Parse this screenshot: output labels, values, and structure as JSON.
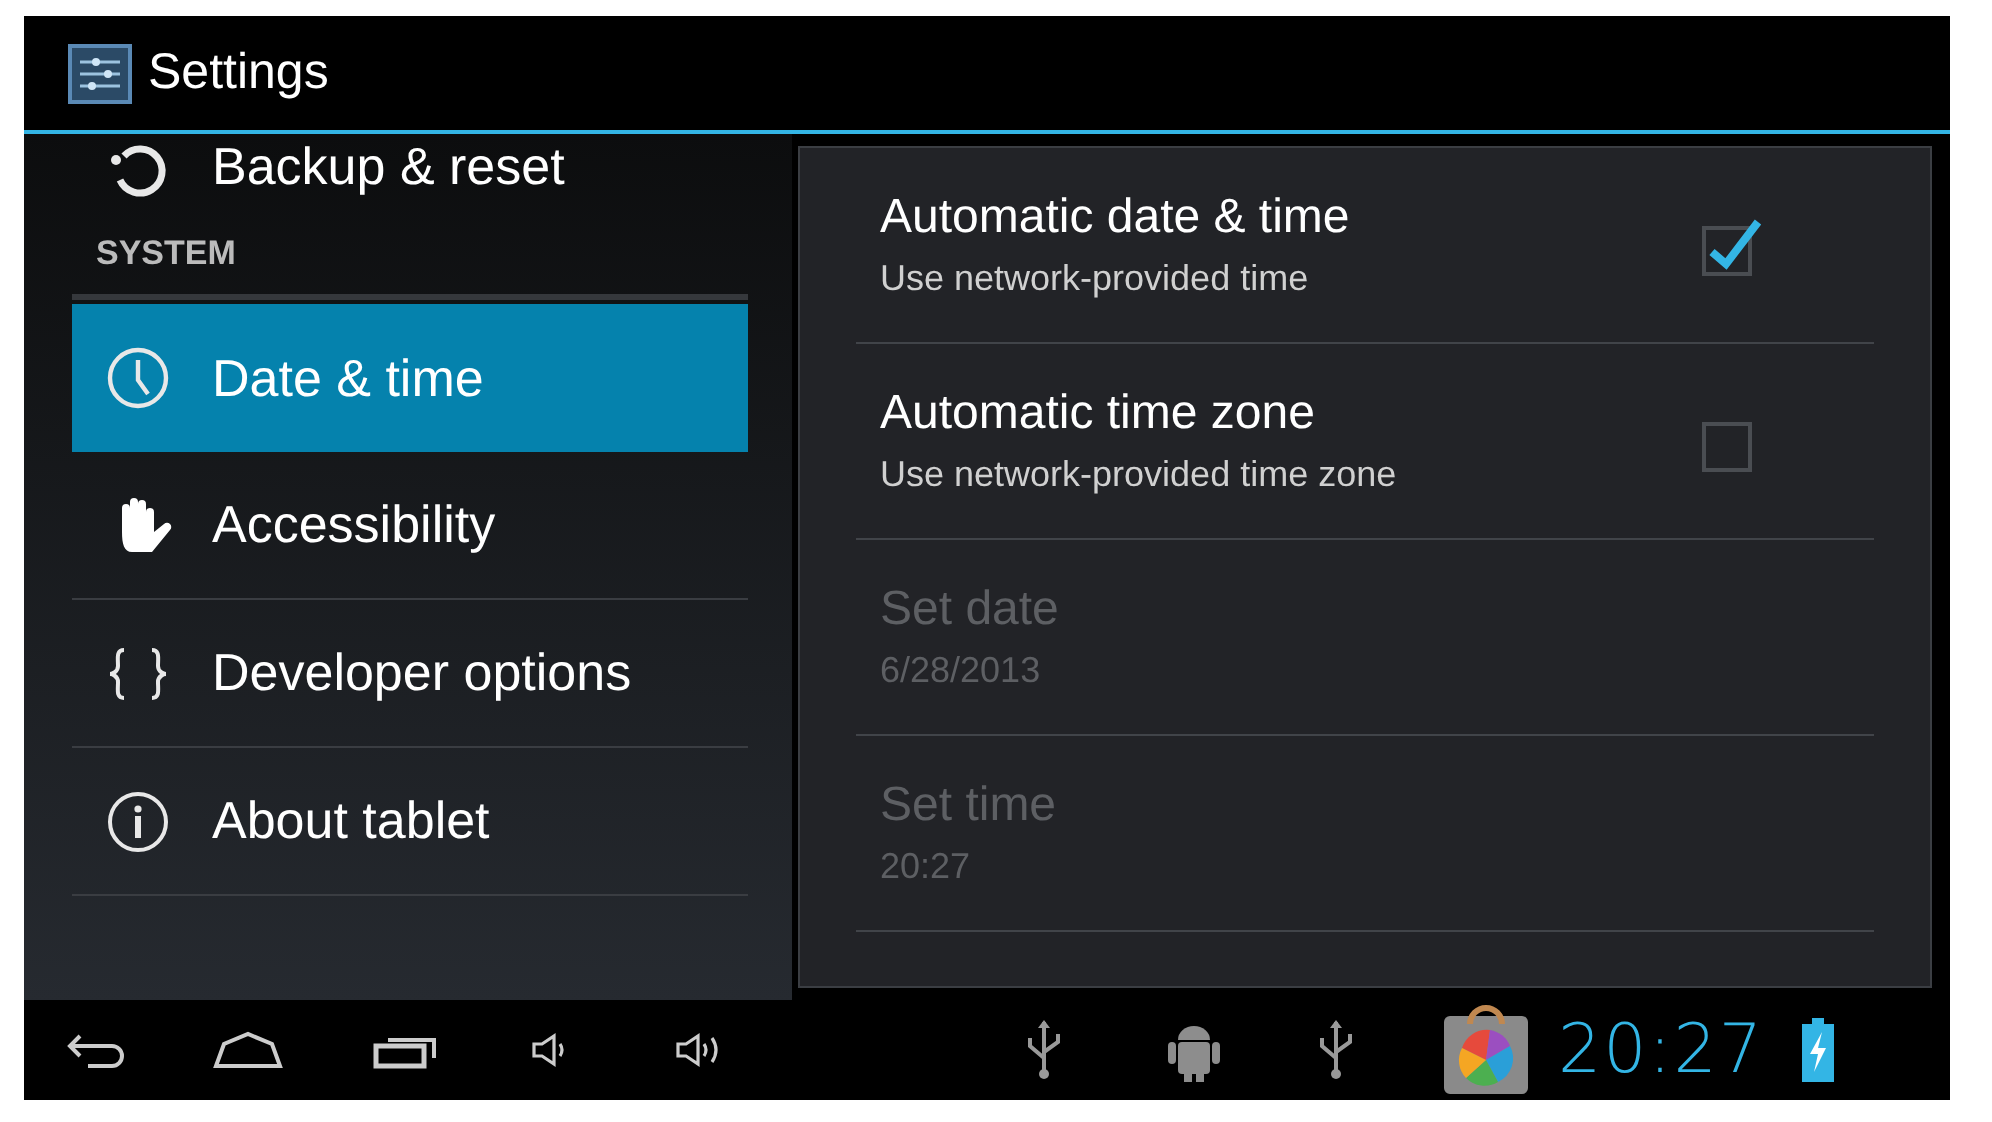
{
  "window": {
    "title": "Settings"
  },
  "sidebar": {
    "items": [
      {
        "kind": "item",
        "label": "Backup & reset",
        "selected": false
      },
      {
        "kind": "header",
        "label": "SYSTEM"
      },
      {
        "kind": "item",
        "label": "Date & time",
        "selected": true
      },
      {
        "kind": "item",
        "label": "Accessibility",
        "selected": false
      },
      {
        "kind": "item",
        "label": "Developer options",
        "selected": false
      },
      {
        "kind": "item",
        "label": "About tablet",
        "selected": false
      }
    ]
  },
  "settings": [
    {
      "kind": "checkbox",
      "title": "Automatic date & time",
      "summary": "Use network-provided time",
      "checked": true,
      "disabled": false
    },
    {
      "kind": "checkbox",
      "title": "Automatic time zone",
      "summary": "Use network-provided time zone",
      "checked": false,
      "disabled": false
    },
    {
      "kind": "plain",
      "title": "Set date",
      "summary": "6/28/2013",
      "disabled": true
    },
    {
      "kind": "plain",
      "title": "Set time",
      "summary": "20:27",
      "disabled": true
    }
  ],
  "status_bar": {
    "clock": "20:27"
  }
}
